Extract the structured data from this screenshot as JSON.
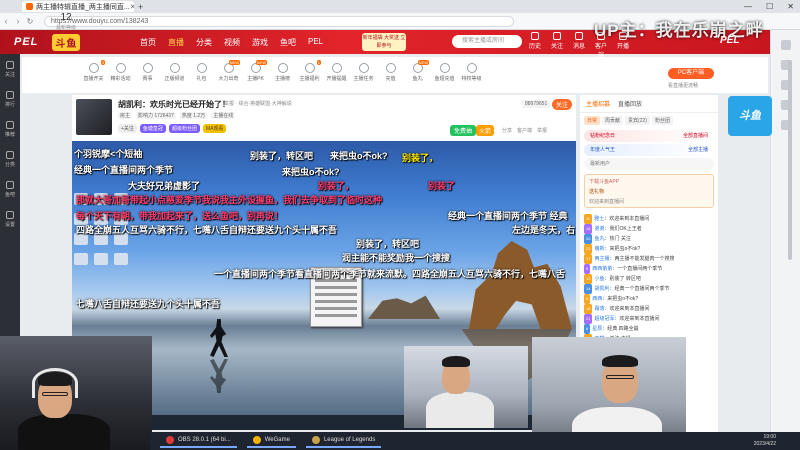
{
  "browser": {
    "tab_title": "两主播特辑直播_两主播同直...",
    "url": "https://www.douyu.com/138243",
    "window_controls": [
      "—",
      "☐",
      "✕"
    ]
  },
  "overlay": {
    "title": "UP主：我在乐崩之畔",
    "corner_logo": "PEL"
  },
  "header": {
    "logo_text": "PEL",
    "logo_sub": "斗鱼",
    "nav": [
      "首页",
      "直播",
      "分类",
      "视频",
      "游戏",
      "鱼吧",
      "PEL"
    ],
    "active_nav": "直播",
    "promo": "新年福袋 大奖送 立即参与",
    "search_placeholder": "搜索主播或房间",
    "icons": [
      "历史",
      "关注",
      "消息",
      "客户端",
      "开播"
    ]
  },
  "left_sidebar": [
    "关注",
    "排行",
    "推荐",
    "分类",
    "鱼吧",
    "设置"
  ],
  "category_strip": {
    "level_value": "12",
    "level_label": "最新等级",
    "items": [
      {
        "label": "直播开关",
        "badge": "3"
      },
      {
        "label": "精彩活动",
        "badge": ""
      },
      {
        "label": "赛事",
        "badge": ""
      },
      {
        "label": "正版频道",
        "badge": ""
      },
      {
        "label": "礼包",
        "badge": ""
      },
      {
        "label": "大力出奇",
        "badge": "NEW"
      },
      {
        "label": "主播PK",
        "badge": "NEW"
      },
      {
        "label": "主播榜",
        "badge": ""
      },
      {
        "label": "主播福利",
        "badge": "1"
      },
      {
        "label": "开播提醒",
        "badge": ""
      },
      {
        "label": "主播任务",
        "badge": ""
      },
      {
        "label": "充值",
        "badge": ""
      },
      {
        "label": "鱼丸",
        "badge": "NEW"
      },
      {
        "label": "鱼翅充值",
        "badge": ""
      },
      {
        "label": "特权等级",
        "badge": ""
      }
    ],
    "pc_button": "PC客户端",
    "pc_sub": "看直播更流畅"
  },
  "brand_badge": "斗鱼",
  "room": {
    "title": "胡凯利：欢乐时光已经开始了！",
    "category": "举报 · 综合·英雄联盟·大神解说",
    "meta": [
      "房主",
      "影响力 1726437",
      "热度 1.2万",
      "主播在线"
    ],
    "tags": [
      {
        "text": "+关注",
        "style": "w"
      },
      {
        "text": "鱼塘皇冠",
        "style": "p"
      },
      {
        "text": "超级粉丝团",
        "style": "p"
      },
      {
        "text": "MA观看",
        "style": "y"
      }
    ],
    "rank": "88979651",
    "follow_label": "关注",
    "lottery_label": "免费抽",
    "lottery2_label": "火箭",
    "actions": [
      "分享",
      "客户端",
      "举报"
    ]
  },
  "danmaku": [
    {
      "text": "个羽锐摩<个短袖",
      "color": "#ffffff"
    },
    {
      "text": "别装了，转区吧",
      "color": "#ffffff"
    },
    {
      "text": "来把虫o不ok?",
      "color": "#ffffff"
    },
    {
      "text": "别装了，",
      "color": "#ffea00"
    },
    {
      "text": "经典一个直播间两个季节",
      "color": "#ffffff"
    },
    {
      "text": "来把虫o不ok?",
      "color": "#ffffff"
    },
    {
      "text": "大夫好兄弟虚影了",
      "color": "#ffffff"
    },
    {
      "text": "别装了，",
      "color": "#ff3d6e"
    },
    {
      "text": "别装了",
      "color": "#ff3d6e"
    },
    {
      "text": "那就大哥加哥带起小点慈爱季节我说我主外设握鱼，我们去争取到了临时这种",
      "color": "#ff3d6e"
    },
    {
      "text": "每个天下有朝，带我加起来了，送么鱼吧，别再说！",
      "color": "#ff3d6e"
    },
    {
      "text": "经典一个直播间两个季节 经典",
      "color": "#ffffff"
    },
    {
      "text": "四路全崩五人互骂六骑不行，七嘴八舌自辩还要送九个头十属不吾",
      "color": "#ffffff"
    },
    {
      "text": "左边是冬天，右",
      "color": "#ffffff"
    },
    {
      "text": "别装了，转区吧",
      "color": "#ffffff"
    },
    {
      "text": "润主能不能奖励我一个搜搜",
      "color": "#ffffff"
    },
    {
      "text": "一个直播间两个季节看直播间两个季节就来流默。四路全崩五人互骂六骑不行，七嘴八舌",
      "color": "#ffffff"
    },
    {
      "text": "七嘴八舌自辩还要送九个头十属不吾",
      "color": "#ffffff"
    }
  ],
  "chat": {
    "header": [
      "主播招募",
      "直播回放"
    ],
    "tabs": [
      "日常",
      "周贡献",
      "贵宾(22)",
      "粉丝团"
    ],
    "rank_rows": [
      {
        "name": "钻粉纪念日",
        "value": "全部直播间"
      },
      {
        "name": "年度人气王",
        "value": "全部主播"
      },
      {
        "name": "最新用户",
        "value": ""
      }
    ],
    "gift_box": [
      "下载斗鱼APP",
      "送礼物",
      "欢迎来到直播间"
    ],
    "messages": [
      {
        "lv": "11",
        "style": "",
        "user": "雅士",
        "text": "欢迎来到本直播间"
      },
      {
        "lv": "18",
        "style": "p",
        "user": "弟弟",
        "text": "我们OK上王者"
      },
      {
        "lv": "20",
        "style": "b",
        "user": "鱼丸",
        "text": "热门 关注"
      },
      {
        "lv": "23",
        "style": "",
        "user": "萌新",
        "text": "来把虫o不ok?"
      },
      {
        "lv": "17",
        "style": "",
        "user": "两主播",
        "text": "两主播不能发腿肉一个搜搜"
      },
      {
        "lv": "9",
        "style": "p",
        "user": "西西弟弟",
        "text": "一个直播间两个季节"
      },
      {
        "lv": "12",
        "style": "",
        "user": "小鱼",
        "text": "别装了 转区吧"
      },
      {
        "lv": "14",
        "style": "b",
        "user": "胡凯利",
        "text": "经典一个直播间两个季节"
      },
      {
        "lv": "8",
        "style": "",
        "user": "西西",
        "text": "来把虫o不ok?"
      },
      {
        "lv": "15",
        "style": "",
        "user": "霜落",
        "text": "欢迎来到本直播间"
      },
      {
        "lv": "21",
        "style": "p",
        "user": "超级冠军",
        "text": "欢迎来到本直播间"
      },
      {
        "lv": "6",
        "style": "b",
        "user": "星辰",
        "text": "经典 四路全崩"
      },
      {
        "lv": "10",
        "style": "",
        "user": "夜猫",
        "text": "关注 主播"
      },
      {
        "lv": "19",
        "style": "p",
        "user": "阿浪",
        "text": "来把虫o不ok?"
      },
      {
        "lv": "13",
        "style": "",
        "user": "王五",
        "text": "经典一个直播间两个季节"
      }
    ]
  },
  "taskbar": {
    "apps": [
      {
        "label": "OBS 28.0.1 (64 bi...",
        "color": "#e03a3a"
      },
      {
        "label": "WeGame",
        "color": "#f0b400"
      },
      {
        "label": "League of Legends",
        "color": "#c8a24a"
      }
    ],
    "time": "19:00",
    "date": "2023/4/22"
  }
}
